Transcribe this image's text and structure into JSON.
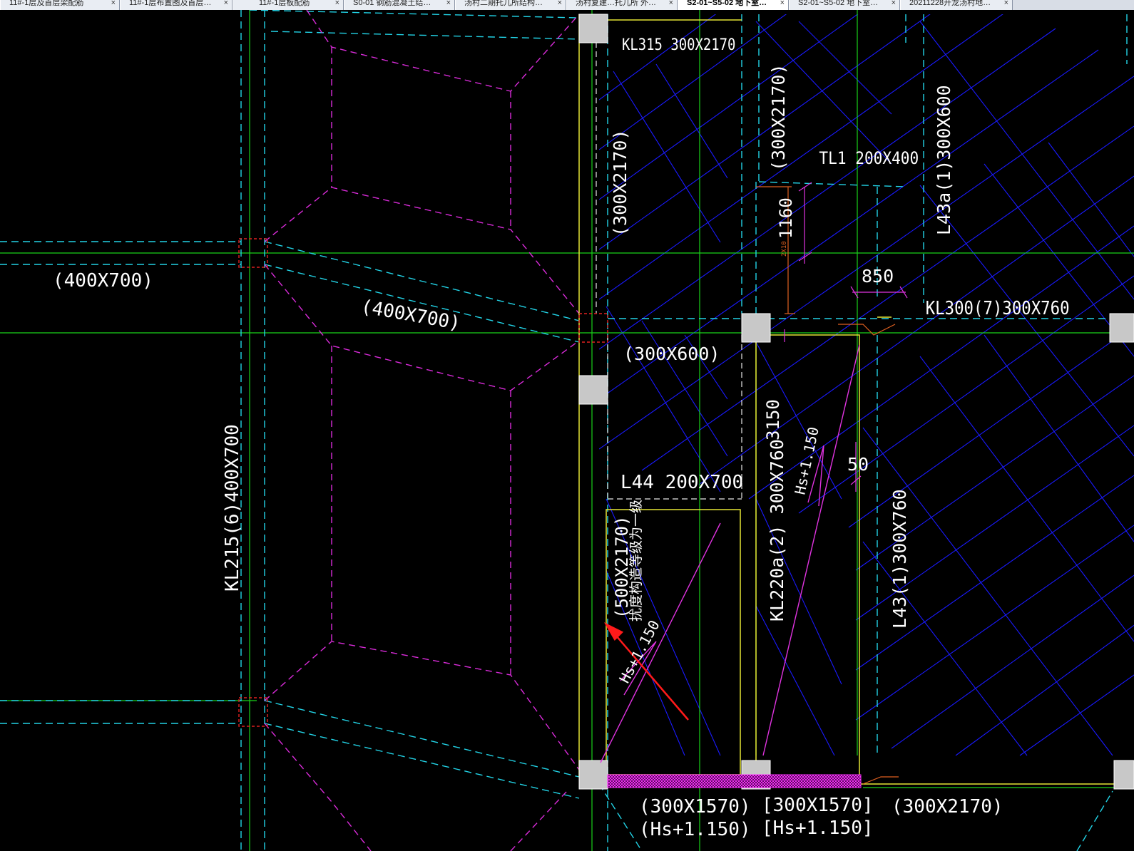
{
  "tabs": [
    {
      "label": "11#-1层及首层梁配筋",
      "close": "×"
    },
    {
      "label": "11#-1层布置图及首层…",
      "close": "×"
    },
    {
      "label": "11#-1层板配筋",
      "close": "×"
    },
    {
      "label": "S0-01 钢筋混凝土结…",
      "close": "×"
    },
    {
      "label": "汤村二期托儿所结构…",
      "close": "×"
    },
    {
      "label": "汤村复建…托儿所 外…",
      "close": "×"
    },
    {
      "label": "S2-01~S5-02 地下室…",
      "close": "×",
      "active": true
    },
    {
      "label": "S2-01~S5-02 地下室…",
      "close": "×"
    },
    {
      "label": "20211228开龙汤村地…",
      "close": "×"
    }
  ],
  "labels": {
    "kl315": "KL315 300X2170",
    "col_300x2170_a": "(300X2170)",
    "col_300x2170_b": "(300X2170)",
    "tl1": "TL1 200X400",
    "l43a": "L43a(1)300X600",
    "dim_1160": "1160",
    "dim_small": "2X10",
    "dim_850": "850",
    "kl300": "KL300(7)300X760",
    "b400x700_a": "(400X700)",
    "b400x700_b": "(400X700)",
    "b300x600": "(300X600)",
    "dim_3150": "3150",
    "hs_upper": "Hs+1.150",
    "dim_50": "50",
    "l44": "L44 200X700",
    "kl220a": "KL220a(2) 300X760",
    "l43": "L43(1)300X760",
    "kl215": "KL215(6)400X700",
    "b500x2170": "(500X2170)",
    "note_cn": "扰度构造等级为一级",
    "hs_lower": "Hs+1.150",
    "b300x1570_a": "(300X1570)",
    "hs_a": "(Hs+1.150)",
    "b300x1570_b": "[300X1570]",
    "hs_b": "[Hs+1.150]",
    "b300x2170_c": "(300X2170)"
  }
}
